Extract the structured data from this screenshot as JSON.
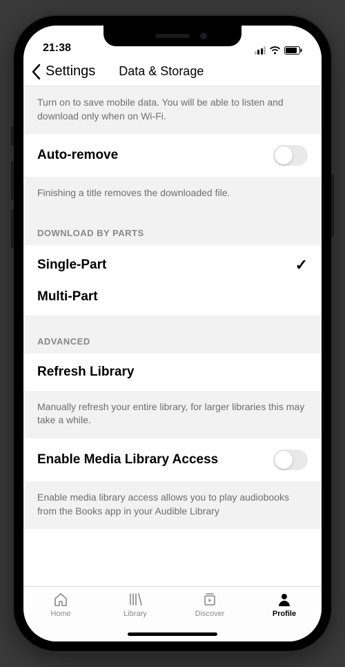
{
  "status": {
    "time": "21:38"
  },
  "nav": {
    "back_label": "Settings",
    "title": "Data & Storage"
  },
  "section_wifi_desc": "Turn on to save mobile data. You will be able to listen and download only when on Wi-Fi.",
  "auto_remove": {
    "label": "Auto-remove",
    "desc": "Finishing a title removes the downloaded file.",
    "enabled": false
  },
  "download_parts": {
    "header": "DOWNLOAD BY PARTS",
    "options": [
      {
        "label": "Single-Part",
        "selected": true
      },
      {
        "label": "Multi-Part",
        "selected": false
      }
    ]
  },
  "advanced": {
    "header": "ADVANCED",
    "refresh": {
      "label": "Refresh Library",
      "desc": "Manually refresh your entire library, for larger libraries this may take a while."
    },
    "media_access": {
      "label": "Enable Media Library Access",
      "desc": "Enable media library access allows you to play audiobooks from the Books app in your Audible Library",
      "enabled": false
    }
  },
  "tabs": [
    {
      "label": "Home"
    },
    {
      "label": "Library"
    },
    {
      "label": "Discover"
    },
    {
      "label": "Profile"
    }
  ]
}
